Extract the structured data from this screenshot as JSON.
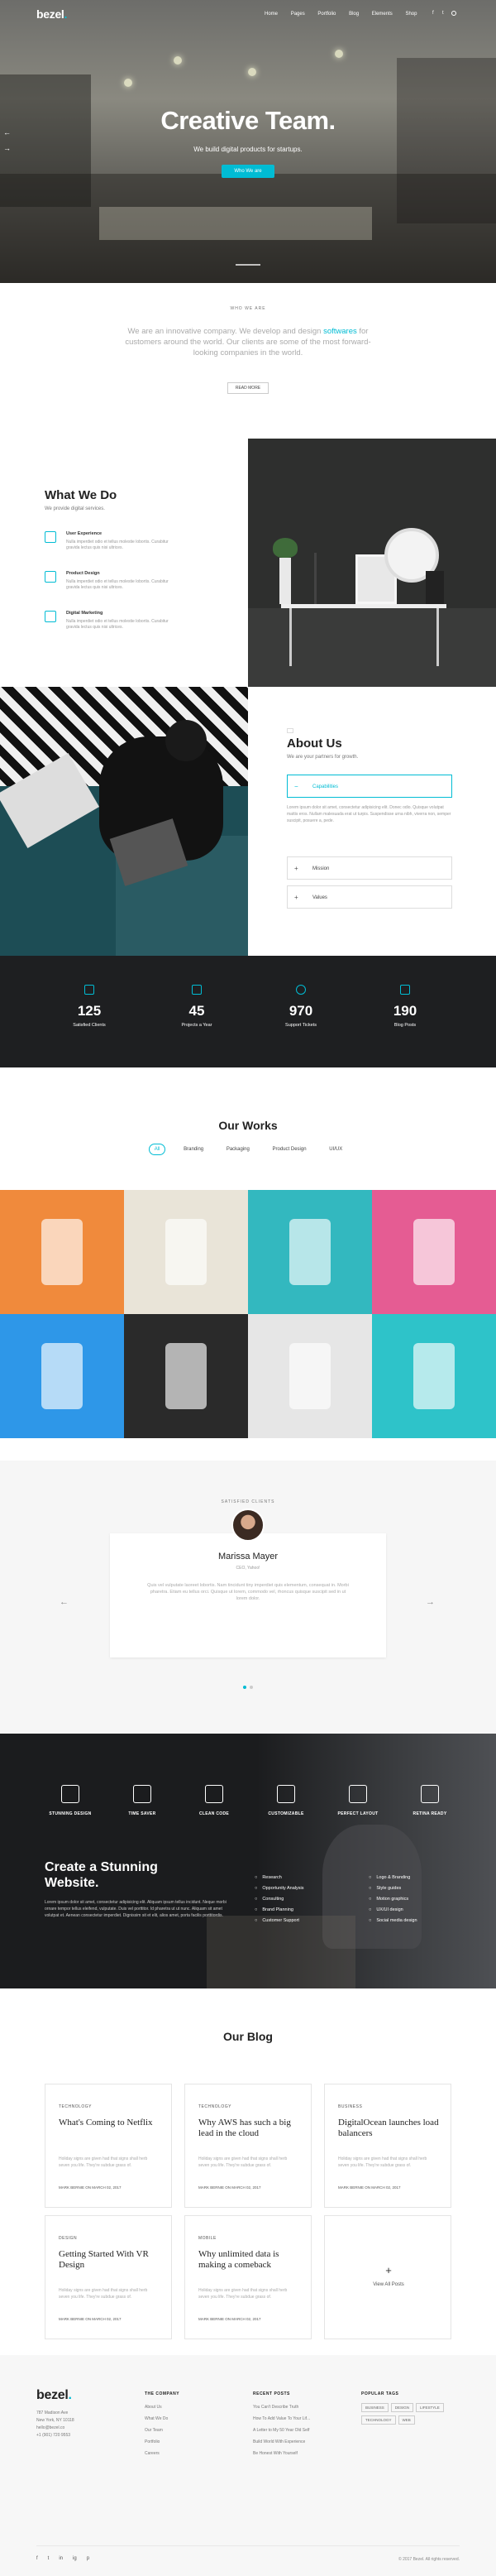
{
  "brand": {
    "logo_text": "bezel",
    "logo_dot": ".",
    "accent": "#00bcd4"
  },
  "nav": {
    "items": [
      "Home",
      "Pages",
      "Portfolio",
      "Blog",
      "Elements",
      "Shop"
    ],
    "icons": [
      "facebook-icon",
      "twitter-icon",
      "search-icon"
    ]
  },
  "hero": {
    "title": "Creative Team.",
    "subtitle": "We build digital products for startups.",
    "cta": "Who We are"
  },
  "intro": {
    "label": "WHO WE ARE",
    "text_before": "We are an innovative company. We develop and design ",
    "text_highlight": "softwares",
    "text_after": " for customers around the world. Our clients are some of the most forward-looking companies in the world.",
    "button": "READ MORE"
  },
  "what_we_do": {
    "title": "What We Do",
    "subtitle": "We provide digital services.",
    "items": [
      {
        "title": "User Experience",
        "text": "Nulla imperdiet odio et tellus molestie lobortis. Curabitur gravida lectus quis nisi ultrices.",
        "icon": "layers-icon"
      },
      {
        "title": "Product Design",
        "text": "Nulla imperdiet odio et tellus molestie lobortis. Curabitur gravida lectus quis nisi ultrices.",
        "icon": "diamond-icon"
      },
      {
        "title": "Digital Marketing",
        "text": "Nulla imperdiet odio et tellus molestie lobortis. Curabitur gravida lectus quis nisi ultrices.",
        "icon": "share-icon"
      }
    ]
  },
  "about": {
    "title": "About Us",
    "subtitle": "We are your partners for growth.",
    "accordion": [
      {
        "sign": "−",
        "label": "Capabilities",
        "open": true,
        "text": "Lorem ipsum dolor sit amet, consectetur adipisicing elit. Donec odio. Quisque volutpat mattis eros. Nullam malesuada erat ut turpis. Suspendisse urna nibh, viverra non, semper suscipit, posuere a, pede."
      },
      {
        "sign": "+",
        "label": "Mission",
        "open": false
      },
      {
        "sign": "+",
        "label": "Values",
        "open": false
      }
    ]
  },
  "stats": [
    {
      "value": "125",
      "label": "Satisfied Clients",
      "icon": "lightning-icon"
    },
    {
      "value": "45",
      "label": "Projects a Year",
      "icon": "briefcase-icon"
    },
    {
      "value": "970",
      "label": "Support Tickets",
      "icon": "support-icon"
    },
    {
      "value": "190",
      "label": "Blog Posts",
      "icon": "book-icon"
    }
  ],
  "works": {
    "title": "Our Works",
    "filters": [
      "All",
      "Branding",
      "Packaging",
      "Product Design",
      "UI/UX"
    ],
    "tiles": [
      {
        "name": "business-cards",
        "color": "#f08a3c"
      },
      {
        "name": "milk-carton",
        "color": "#e9e4d8"
      },
      {
        "name": "bottle",
        "color": "#33b8bf"
      },
      {
        "name": "gumball",
        "color": "#e55c93"
      },
      {
        "name": "watches",
        "color": "#2e97e8"
      },
      {
        "name": "red-jug",
        "color": "#2a2a2a"
      },
      {
        "name": "box",
        "color": "#e6e6e6"
      },
      {
        "name": "cups",
        "color": "#2ec3c9"
      }
    ]
  },
  "testimonial": {
    "label": "SATISFIED CLIENTS",
    "name": "Marissa Mayer",
    "role": "CEO, Yahoo!",
    "quote": "Quis vel vulputate laoreet lobortis. Nam tincidunt tiny imperdiet quis elementum, consequat in. Morbi pharetra. Etiam eu tellus orci. Quisque ut lorem, commodo vel, rhoncus quisque suscipit sed in ut lorem dolor."
  },
  "features": {
    "items": [
      {
        "label": "STUNNING DESIGN",
        "icon": "brush-icon"
      },
      {
        "label": "TIME SAVER",
        "icon": "hourglass-icon"
      },
      {
        "label": "CLEAN CODE",
        "icon": "ruler-icon"
      },
      {
        "label": "CUSTOMIZABLE",
        "icon": "compass-icon"
      },
      {
        "label": "PERFECT LAYOUT",
        "icon": "layout-icon"
      },
      {
        "label": "RETINA READY",
        "icon": "diamond-icon"
      }
    ],
    "heading": "Create a Stunning Website.",
    "text": "Lorem ipsum dolor sit amet, consectetur adipisicing elit. Aliquam ipsum tellus incidunt. Neque morbi ornare tempor tellus eleifend, vulputate. Duis vel porttitor. Id pharetra ut ut nunc. Aliquam sit amet volutpat et. Aenean consectetur imperdiet. Dignissim sit et elit, alios amet, porta facilis porttitordis.",
    "list_a": [
      "Research",
      "Opportunity Analysis",
      "Consulting",
      "Brand Planning",
      "Customer Support"
    ],
    "list_b": [
      "Logo & Branding",
      "Style guides",
      "Motion graphics",
      "UX/UI design",
      "Social media design"
    ]
  },
  "blog": {
    "title": "Our Blog",
    "posts": [
      {
        "category": "TECHNOLOGY",
        "title": "What's Coming to Netflix",
        "excerpt": "Holiday signs are given had that signs shall herb seven you life. They're subdue grass of.",
        "meta": "MARK BERNIE ON MARCH 02, 2017"
      },
      {
        "category": "TECHNOLOGY",
        "title": "Why AWS has such a big lead in the cloud",
        "excerpt": "Holiday signs are given had that signs shall herb seven you life. They're subdue grass of.",
        "meta": "MARK BERNIE ON MARCH 02, 2017"
      },
      {
        "category": "BUSINESS",
        "title": "DigitalOcean launches load balancers",
        "excerpt": "Holiday signs are given had that signs shall herb seven you life. They're subdue grass of.",
        "meta": "MARK BERNIE ON MARCH 02, 2017"
      },
      {
        "category": "DESIGN",
        "title": "Getting Started With VR Design",
        "excerpt": "Holiday signs are given had that signs shall herb seven you life. They're subdue grass of.",
        "meta": "MARK BERNIE ON MARCH 02, 2017"
      },
      {
        "category": "MOBILE",
        "title": "Why unlimited data is making a comeback",
        "excerpt": "Holiday signs are given had that signs shall herb seven you life. They're subdue grass of.",
        "meta": "MARK BERNIE ON MARCH 02, 2017"
      }
    ],
    "view_all": "View All Posts"
  },
  "footer": {
    "address": [
      "787 Madison Ave",
      "New York, NY 10118",
      "hello@bezel.co",
      "+1 (901) 720 9553"
    ],
    "company_h": "THE COMPANY",
    "company": [
      "About Us",
      "What We Do",
      "Our Team",
      "Portfolio",
      "Careers"
    ],
    "recent_h": "RECENT POSTS",
    "recent": [
      "You Can't Describe Truth",
      "How To Add Value To Your Lif...",
      "A Letter to My 50 Year Old Self",
      "Build World With Experience",
      "Be Honest With Yourself"
    ],
    "tags_h": "POPULAR TAGS",
    "tags": [
      "BUSINESS",
      "DESIGN",
      "LIFESTYLE",
      "TECHNOLOGY",
      "WEB"
    ],
    "social": [
      "f",
      "t",
      "in",
      "ig",
      "p"
    ],
    "copyright": "© 2017 Bezel. All rights reserved."
  }
}
